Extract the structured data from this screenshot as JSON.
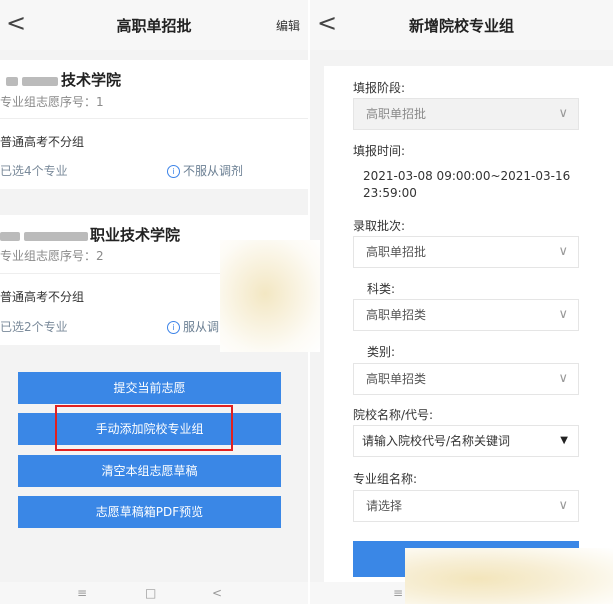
{
  "left": {
    "header": {
      "back": "<",
      "title": "高职单招批",
      "edit": "编辑"
    },
    "cards": [
      {
        "school_suffix": "技术学院",
        "order_label": "专业组志愿序号：1",
        "group": "普通高考不分组",
        "selected": "已选4个专业",
        "adjust": "不服从调剂"
      },
      {
        "school_suffix": "职业技术学院",
        "order_label": "专业组志愿序号：2",
        "group": "普通高考不分组",
        "selected": "已选2个专业",
        "adjust": "服从调"
      }
    ],
    "buttons": {
      "submit": "提交当前志愿",
      "add": "手动添加院校专业组",
      "clear": "清空本组志愿草稿",
      "preview": "志愿草稿箱PDF预览"
    },
    "navbar": {
      "menu": "≡",
      "home": "□",
      "back": "<"
    }
  },
  "right": {
    "header": {
      "back": "<",
      "title": "新增院校专业组"
    },
    "fields": {
      "stage_label": "填报阶段:",
      "stage_value": "高职单招批",
      "time_label": "填报时间:",
      "time_value": "2021-03-08 09:00:00~2021-03-16",
      "time_value2": "23:59:00",
      "batch_label": "录取批次:",
      "batch_value": "高职单招批",
      "subject_label": "科类:",
      "subject_value": "高职单招类",
      "category_label": "类别:",
      "category_value": "高职单招类",
      "school_label": "院校名称/代号:",
      "school_placeholder": "请输入院校代号/名称关键词",
      "group_label": "专业组名称:",
      "group_value": "请选择"
    },
    "navbar": {
      "menu": "≡"
    }
  },
  "colors": {
    "accent": "#3a87e6",
    "highlight": "#e02020"
  }
}
